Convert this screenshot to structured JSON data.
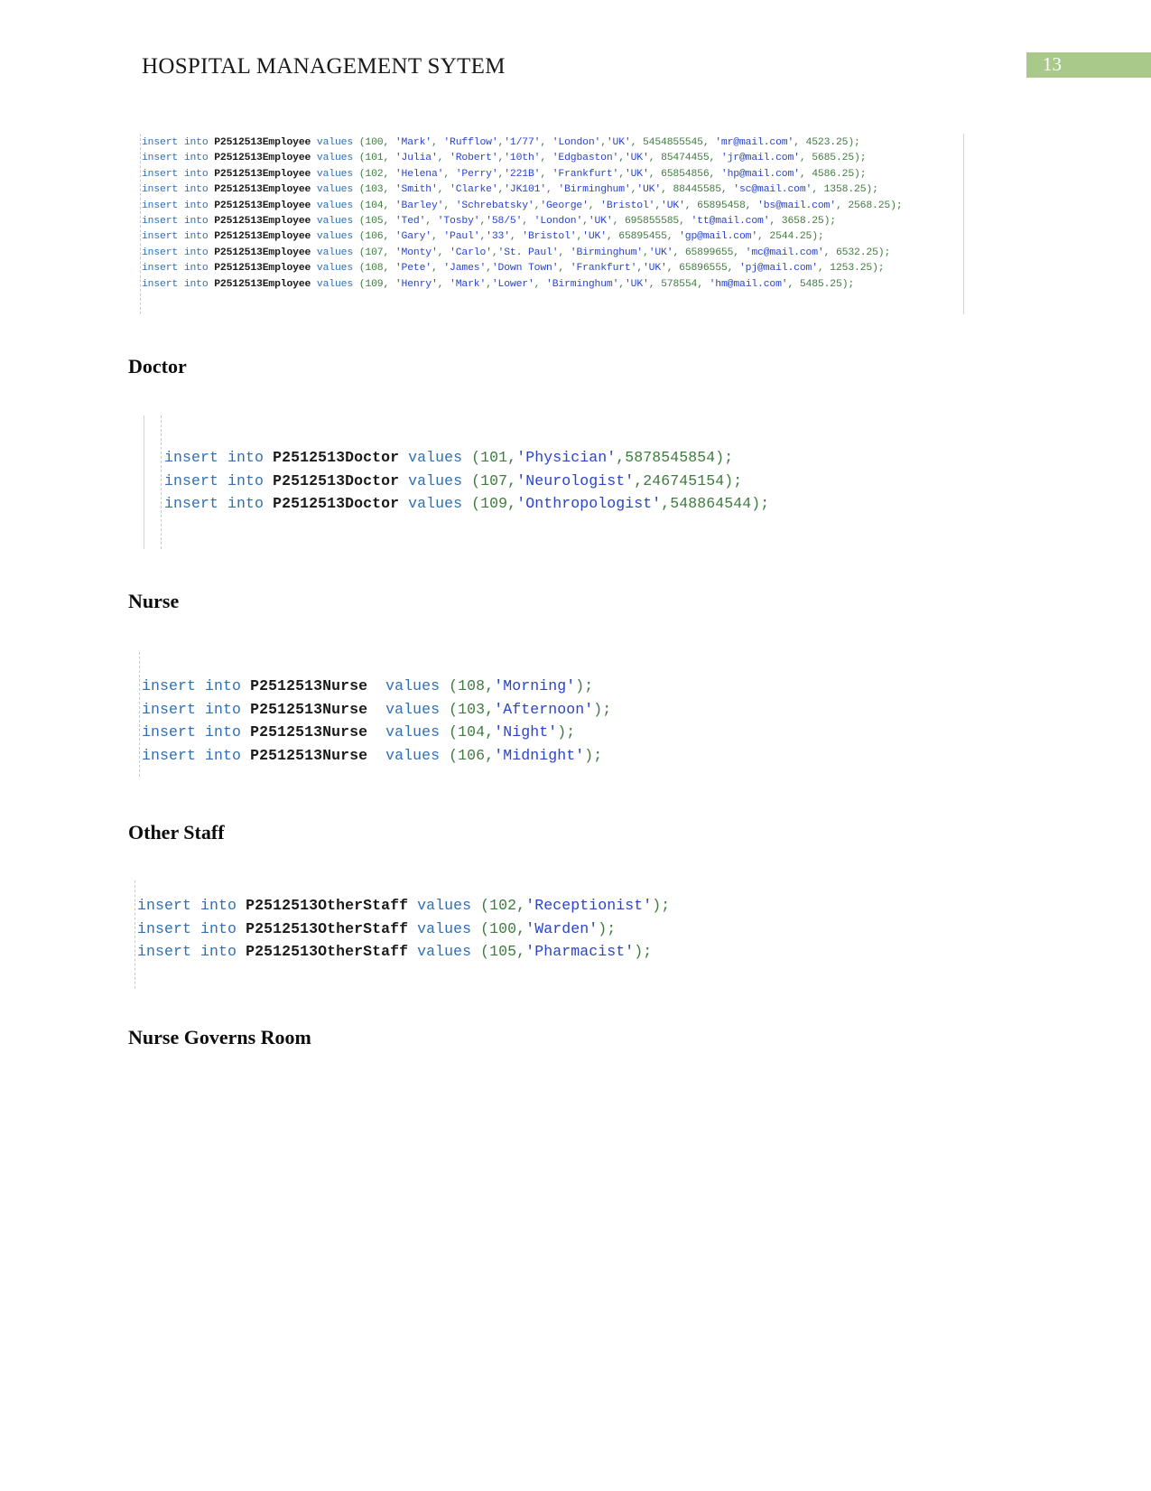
{
  "document": {
    "header_title": "HOSPITAL MANAGEMENT SYTEM",
    "page_number": "13"
  },
  "theme": {
    "banner_green": "#a9c98b",
    "keyword_blue": "#2f6fb5",
    "string_blue": "#2a44c8",
    "number_green": "#3f7a3f",
    "text_black": "#1f1f1f"
  },
  "sections": {
    "doctor_heading": "Doctor",
    "nurse_heading": "Nurse",
    "otherstaff_heading": "Other Staff",
    "nursegoverns_heading": "Nurse Governs Room"
  },
  "code_blocks": {
    "employee": {
      "table": "P2512513Employee",
      "lines": [
        "insert into P2512513Employee values (100, 'Mark', 'Rufflow','1/77', 'London','UK', 5454855545, 'mr@mail.com', 4523.25);",
        "insert into P2512513Employee values (101, 'Julia', 'Robert','10th', 'Edgbaston','UK', 85474455, 'jr@mail.com', 5685.25);",
        "insert into P2512513Employee values (102, 'Helena', 'Perry','221B', 'Frankfurt','UK', 65854856, 'hp@mail.com', 4586.25);",
        "insert into P2512513Employee values (103, 'Smith', 'Clarke','JK101', 'Birminghum','UK', 88445585, 'sc@mail.com', 1358.25);",
        "insert into P2512513Employee values (104, 'Barley', 'Schrebatsky','George', 'Bristol','UK', 65895458, 'bs@mail.com', 2568.25);",
        "insert into P2512513Employee values (105, 'Ted', 'Tosby','58/5', 'London','UK', 695855585, 'tt@mail.com', 3658.25);",
        "insert into P2512513Employee values (106, 'Gary', 'Paul','33', 'Bristol','UK', 65895455, 'gp@mail.com', 2544.25);",
        "insert into P2512513Employee values (107, 'Monty', 'Carlo','St. Paul', 'Birminghum','UK', 65899655, 'mc@mail.com', 6532.25);",
        "insert into P2512513Employee values (108, 'Pete', 'James','Down Town', 'Frankfurt','UK', 65896555, 'pj@mail.com', 1253.25);",
        "insert into P2512513Employee values (109, 'Henry', 'Mark','Lower', 'Birminghum','UK', 578554, 'hm@mail.com', 5485.25);"
      ]
    },
    "doctor": {
      "table": "P2512513Doctor",
      "lines": [
        "insert into P2512513Doctor values (101,'Physician',5878545854);",
        "insert into P2512513Doctor values (107,'Neurologist',246745154);",
        "insert into P2512513Doctor values (109,'Onthropologist',548864544);"
      ]
    },
    "nurse": {
      "table": "P2512513Nurse",
      "lines": [
        "insert into P2512513Nurse  values (108,'Morning');",
        "insert into P2512513Nurse  values (103,'Afternoon');",
        "insert into P2512513Nurse  values (104,'Night');",
        "insert into P2512513Nurse  values (106,'Midnight');"
      ]
    },
    "otherstaff": {
      "table": "P2512513OtherStaff",
      "lines": [
        "insert into P2512513OtherStaff values (102,'Receptionist');",
        "insert into P2512513OtherStaff values (100,'Warden');",
        "insert into P2512513OtherStaff values (105,'Pharmacist');"
      ]
    }
  }
}
